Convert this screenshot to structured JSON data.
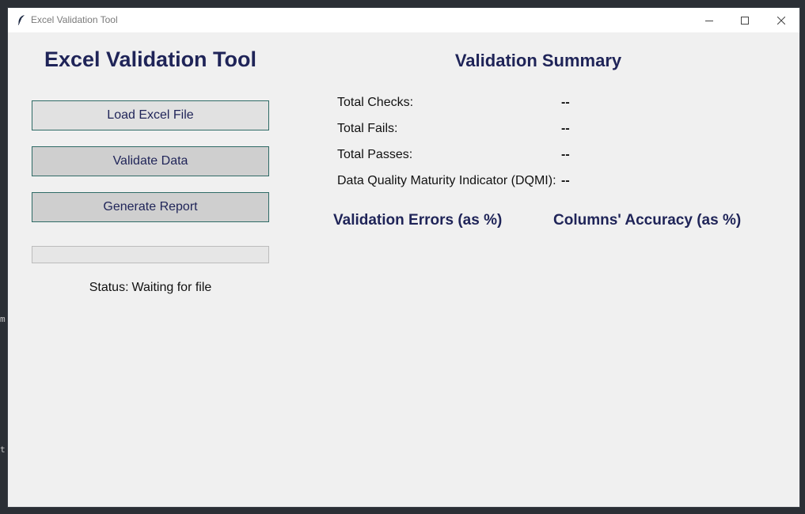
{
  "background": {
    "fragment_1": "m",
    "fragment_2": "t"
  },
  "window": {
    "title": "Excel Validation Tool",
    "icon": "feather-icon",
    "controls": [
      "minimize-icon",
      "maximize-icon",
      "close-icon"
    ]
  },
  "left_panel": {
    "title": "Excel Validation Tool",
    "load_button": "Load Excel File",
    "validate_button": "Validate Data",
    "report_button": "Generate Report",
    "progress": 0,
    "status_label": "Status:",
    "status_value": "Waiting for file"
  },
  "summary": {
    "title": "Validation Summary",
    "rows": [
      {
        "label": "Total Checks:",
        "value": "--"
      },
      {
        "label": "Total Fails:",
        "value": "--"
      },
      {
        "label": "Total Passes:",
        "value": "--"
      },
      {
        "label": "Data Quality Maturity Indicator (DQMI):",
        "value": "--"
      }
    ],
    "errors_heading": "Validation Errors (as %)",
    "accuracy_heading": "Columns' Accuracy (as %)"
  },
  "colors": {
    "heading": "#1f2458",
    "button_border": "#2f6b66",
    "window_bg": "#f0f0f0",
    "desktop_bg": "#2b2f35"
  }
}
